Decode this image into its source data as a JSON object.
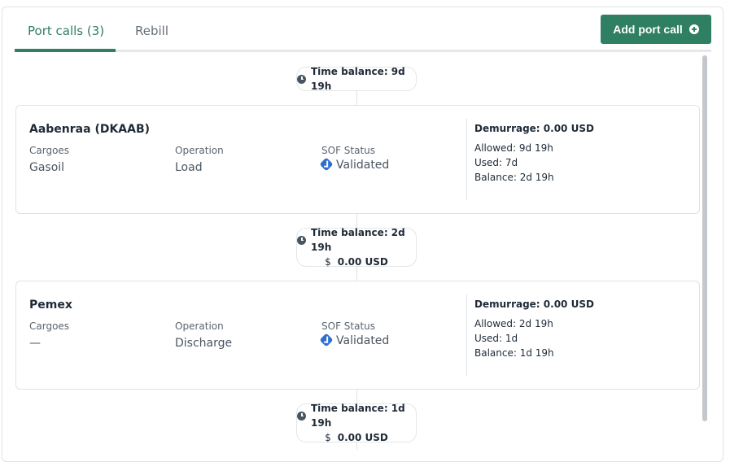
{
  "tabs": [
    {
      "label": "Port calls (3)",
      "active": true
    },
    {
      "label": "Rebill",
      "active": false
    }
  ],
  "add_button": {
    "label": "Add port call",
    "icon": "plus-circle-icon"
  },
  "colors": {
    "accent": "#2f7f63",
    "validated": "#2c6fd1"
  },
  "balances": [
    {
      "time": "Time balance: 9d 19h",
      "amount": ""
    },
    {
      "time": "Time balance: 2d 19h",
      "amount": "0.00 USD",
      "currency_symbol": "$"
    },
    {
      "time": "Time balance: 1d 19h",
      "amount": "0.00 USD",
      "currency_symbol": "$"
    }
  ],
  "port_calls": [
    {
      "name": "Aabenraa (DKAAB)",
      "cargoes_label": "Cargoes",
      "cargoes": "Gasoil",
      "operation_label": "Operation",
      "operation": "Load",
      "sof_label": "SOF Status",
      "sof": "Validated",
      "demurrage": "Demurrage: 0.00 USD",
      "allowed": "Allowed: 9d 19h",
      "used": "Used: 7d",
      "balance": "Balance: 2d 19h"
    },
    {
      "name": "Pemex",
      "cargoes_label": "Cargoes",
      "cargoes": "—",
      "operation_label": "Operation",
      "operation": "Discharge",
      "sof_label": "SOF Status",
      "sof": "Validated",
      "demurrage": "Demurrage: 0.00 USD",
      "allowed": "Allowed: 2d 19h",
      "used": "Used: 1d",
      "balance": "Balance: 1d 19h"
    }
  ]
}
